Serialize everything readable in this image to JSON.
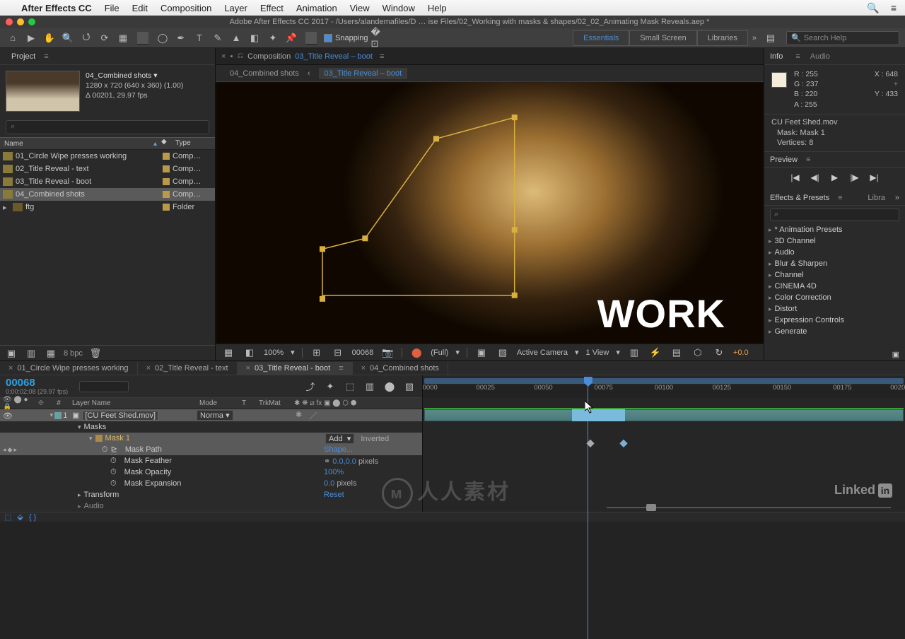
{
  "menubar": {
    "apple": "",
    "app": "After Effects CC",
    "items": [
      "File",
      "Edit",
      "Composition",
      "Layer",
      "Effect",
      "Animation",
      "View",
      "Window",
      "Help"
    ],
    "search_icon": "🔍",
    "list_icon": "≡"
  },
  "titlebar": {
    "title": "Adobe After Effects CC 2017 - /Users/alandemafiles/D … ise Files/02_Working with masks & shapes/02_02_Animating Mask Reveals.aep *"
  },
  "toolrow": {
    "snapping_label": "Snapping",
    "workspaces": [
      "Essentials",
      "Small Screen",
      "Libraries"
    ],
    "active_ws": 0,
    "search_placeholder": "Search Help"
  },
  "project": {
    "panel_title": "Project",
    "selected_name": "04_Combined shots ▾",
    "meta1": "1280 x 720  (640 x 360) (1.00)",
    "meta2": "Δ 00201, 29.97 fps",
    "headers": {
      "name": "Name",
      "type": "Type"
    },
    "items": [
      {
        "name": "01_Circle Wipe presses working",
        "type": "Comp…"
      },
      {
        "name": "02_Title Reveal - text",
        "type": "Comp…"
      },
      {
        "name": "03_Title Reveal - boot",
        "type": "Comp…"
      },
      {
        "name": "04_Combined shots",
        "type": "Comp…"
      },
      {
        "name": "ftg",
        "type": "Folder"
      }
    ],
    "selected_index": 3,
    "bpc": "8 bpc"
  },
  "comp_header": {
    "prefix": "Composition",
    "name": "03_Title Reveal – boot",
    "breadcrumbs": [
      "04_Combined shots",
      "03_Title Reveal – boot"
    ]
  },
  "viewer": {
    "title_text": "WORK"
  },
  "view_footer": {
    "zoom": "100%",
    "frame": "00068",
    "res": "(Full)",
    "camera": "Active Camera",
    "views": "1 View",
    "exposure": "+0.0"
  },
  "info": {
    "tab1": "Info",
    "tab2": "Audio",
    "R": "R : 255",
    "G": "G : 237",
    "B": "B : 220",
    "A": "A : 255",
    "X": "X : 648",
    "Y": "Y : 433",
    "sel1": "CU Feet Shed.mov",
    "sel2": "Mask: Mask 1",
    "sel3": "Vertices: 8"
  },
  "preview": {
    "title": "Preview"
  },
  "effects": {
    "title": "Effects & Presets",
    "tab2": "Libra",
    "items": [
      "* Animation Presets",
      "3D Channel",
      "Audio",
      "Blur & Sharpen",
      "Channel",
      "CINEMA 4D",
      "Color Correction",
      "Distort",
      "Expression Controls",
      "Generate"
    ]
  },
  "timeline": {
    "tabs": [
      "01_Circle Wipe presses working",
      "02_Title Reveal - text",
      "03_Title Reveal - boot",
      "04_Combined shots"
    ],
    "active_tab": 2,
    "current_frame": "00068",
    "timecode_sub": "0;00;02;08 (29.97 fps)",
    "col": {
      "num": "#",
      "name": "Layer Name",
      "mode": "Mode",
      "t": "T",
      "trk": "TrkMat"
    },
    "layer1": {
      "num": "1",
      "name": "[CU Feet Shed.mov]",
      "mode": "Norma"
    },
    "masks_label": "Masks",
    "mask1": "Mask 1",
    "mask1_mode": "Add",
    "mask1_inverted": "Inverted",
    "p_maskpath": "Mask Path",
    "v_maskpath": "Shape...",
    "p_feather": "Mask Feather",
    "v_feather": "0.0,0.0",
    "v_feather_unit": " pixels",
    "p_opacity": "Mask Opacity",
    "v_opacity": "100%",
    "p_expansion": "Mask Expansion",
    "v_expansion": "0.0",
    "v_expansion_unit": " pixels",
    "p_transform": "Transform",
    "v_transform": "Reset",
    "p_audio": "Audio",
    "ruler_ticks": [
      "0000",
      "00025",
      "00050",
      "00075",
      "00100",
      "00125",
      "00150",
      "00175",
      "0020"
    ],
    "cti_pct": 34.0
  },
  "watermark": "人人素材",
  "linkedin": "Linked"
}
